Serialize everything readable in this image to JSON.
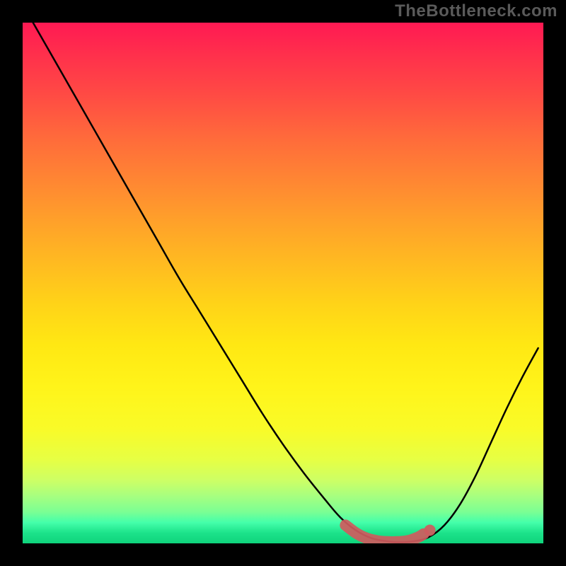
{
  "watermark": "TheBottleneck.com",
  "colors": {
    "frame_bg": "#000000",
    "curve_stroke": "#000000",
    "highlight": "#cf5b5e",
    "gradient_top": "#ff1953",
    "gradient_bottom": "#0fd47c"
  },
  "chart_data": {
    "type": "line",
    "title": "",
    "xlabel": "",
    "ylabel": "",
    "xlim": [
      0,
      100
    ],
    "ylim": [
      0,
      100
    ],
    "x": [
      2,
      6,
      10,
      14,
      18,
      22,
      26,
      30,
      34,
      38,
      42,
      46,
      50,
      54,
      58,
      61,
      64,
      67,
      70,
      72,
      75,
      78,
      81,
      84,
      87,
      90,
      93,
      96,
      99
    ],
    "values": [
      100,
      93,
      86,
      79,
      72,
      65,
      58,
      51,
      44.5,
      38,
      31.5,
      25,
      19,
      13.5,
      8.5,
      5,
      2.5,
      1,
      0.4,
      0.2,
      0.4,
      1.2,
      3.5,
      7.5,
      13,
      19.5,
      26,
      32,
      37.5
    ],
    "highlight_segment": {
      "x": [
        62,
        64,
        66,
        68,
        70,
        72,
        74,
        76,
        77
      ],
      "values": [
        3.5,
        2.0,
        1.0,
        0.5,
        0.3,
        0.3,
        0.5,
        1.2,
        1.8
      ]
    },
    "notes": "y=0 is bottom (green), y=100 is top (red). Curve depicts distance from optimum; minimum (best) lies near x≈71."
  }
}
